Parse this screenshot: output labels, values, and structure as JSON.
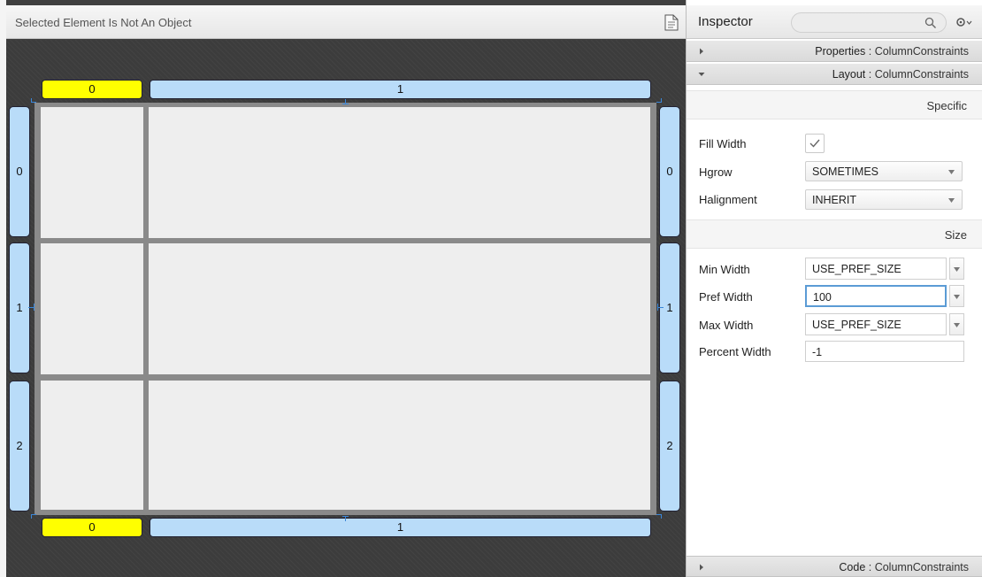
{
  "editor": {
    "header_title": "Selected Element Is Not An Object",
    "column_tabs_top": [
      "0",
      "1"
    ],
    "column_tabs_bottom": [
      "0",
      "1"
    ],
    "row_tabs_left": [
      "0",
      "1",
      "2"
    ],
    "row_tabs_right": [
      "0",
      "1",
      "2"
    ]
  },
  "inspector": {
    "title": "Inspector",
    "search_placeholder": "",
    "sections": {
      "properties": {
        "name": "Properties",
        "separator": " : ",
        "type": "ColumnConstraints",
        "expanded": false
      },
      "layout": {
        "name": "Layout",
        "separator": " : ",
        "type": "ColumnConstraints",
        "expanded": true
      },
      "code": {
        "name": "Code",
        "separator": " : ",
        "type": "ColumnConstraints",
        "expanded": false
      }
    },
    "specific": {
      "heading": "Specific",
      "fill_width_label": "Fill Width",
      "fill_width_checked": true,
      "hgrow_label": "Hgrow",
      "hgrow_value": "SOMETIMES",
      "halignment_label": "Halignment",
      "halignment_value": "INHERIT"
    },
    "size": {
      "heading": "Size",
      "min_width_label": "Min Width",
      "min_width_value": "USE_PREF_SIZE",
      "pref_width_label": "Pref Width",
      "pref_width_value": "100",
      "max_width_label": "Max Width",
      "max_width_value": "USE_PREF_SIZE",
      "percent_width_label": "Percent Width",
      "percent_width_value": "-1"
    }
  },
  "colors": {
    "selected_tab": "#ffff00",
    "tab": "#b9dcf9",
    "focus_ring": "#5b9bd5"
  }
}
